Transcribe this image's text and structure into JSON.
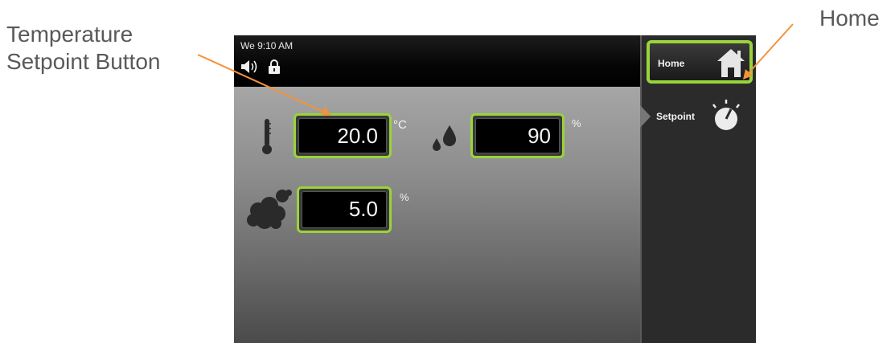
{
  "annotations": {
    "temperature_label_line1": "Temperature",
    "temperature_label_line2": "Setpoint Button",
    "home_label": "Home"
  },
  "status_bar": {
    "day_time": "We 9:10 AM",
    "icons": [
      "speaker-icon",
      "lock-icon"
    ]
  },
  "side_panel": {
    "home_label": "Home",
    "home_icon": "house-icon",
    "setpoint_label": "Setpoint",
    "setpoint_icon": "dial-icon"
  },
  "controls": {
    "temperature": {
      "value": "20.0",
      "unit": "°C",
      "icon": "thermometer-icon"
    },
    "humidity": {
      "value": "90",
      "unit": "%",
      "icon": "water-drops-icon"
    },
    "co2": {
      "value": "5.0",
      "unit": "%",
      "icon": "gas-cloud-icon"
    }
  },
  "colors": {
    "accent_green": "#9bd33a",
    "annotation_orange": "#f4923a",
    "annotation_text": "#595959"
  }
}
